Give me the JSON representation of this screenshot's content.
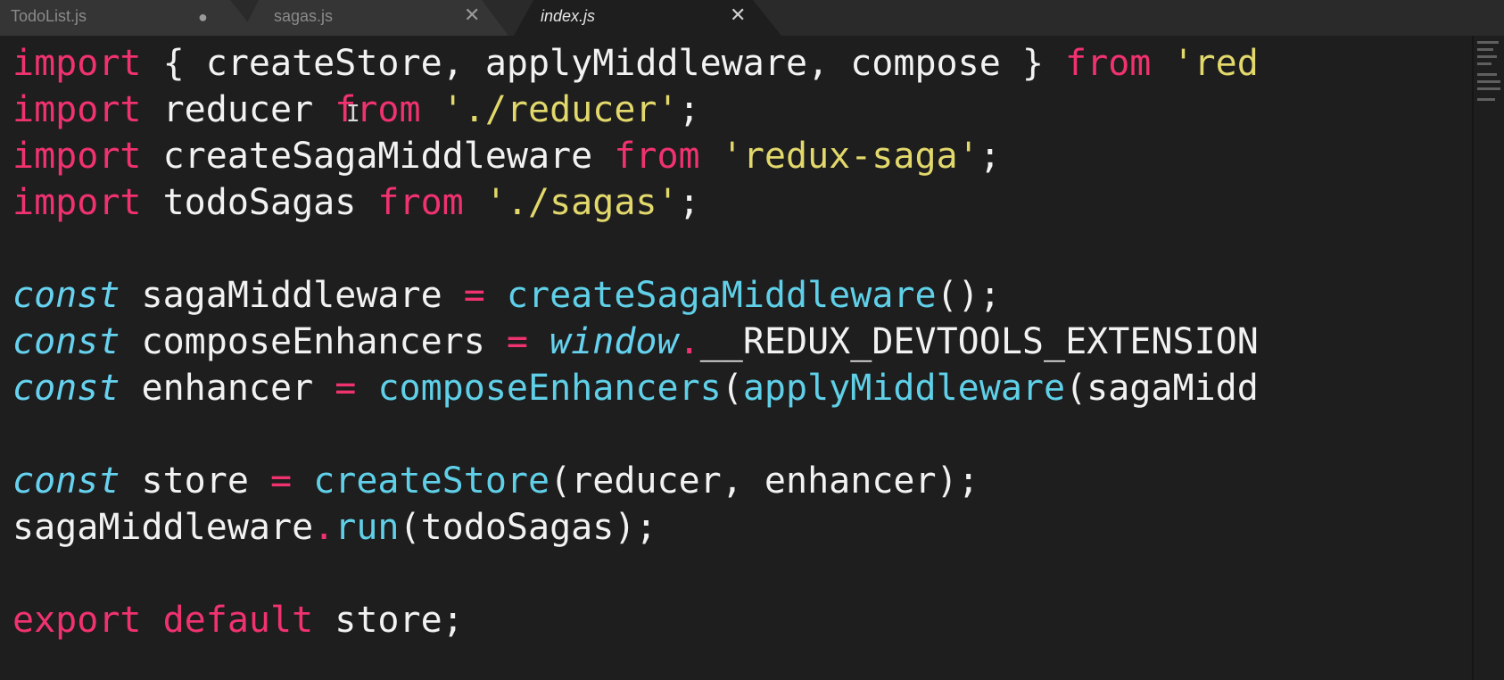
{
  "tabs": [
    {
      "label": "TodoList.js",
      "control": "●",
      "state": "modified"
    },
    {
      "label": "sagas.js",
      "control": "✕",
      "state": "saved"
    },
    {
      "label": "index.js",
      "control": "✕",
      "state": "active"
    }
  ],
  "code_lines": [
    [
      [
        "kw",
        "import"
      ],
      [
        "pl",
        " { createStore, applyMiddleware, compose } "
      ],
      [
        "kw",
        "from"
      ],
      [
        "pl",
        " "
      ],
      [
        "st",
        "'red"
      ]
    ],
    [
      [
        "kw",
        "import"
      ],
      [
        "pl",
        " reducer "
      ],
      [
        "kw",
        "from"
      ],
      [
        "pl",
        " "
      ],
      [
        "st",
        "'./reducer'"
      ],
      [
        "pl",
        ";"
      ]
    ],
    [
      [
        "kw",
        "import"
      ],
      [
        "pl",
        " createSagaMiddleware "
      ],
      [
        "kw",
        "from"
      ],
      [
        "pl",
        " "
      ],
      [
        "st",
        "'redux-saga'"
      ],
      [
        "pl",
        ";"
      ]
    ],
    [
      [
        "kw",
        "import"
      ],
      [
        "pl",
        " todoSagas "
      ],
      [
        "kw",
        "from"
      ],
      [
        "pl",
        " "
      ],
      [
        "st",
        "'./sagas'"
      ],
      [
        "pl",
        ";"
      ]
    ],
    [],
    [
      [
        "sc",
        "const"
      ],
      [
        "pl",
        " sagaMiddleware "
      ],
      [
        "op",
        "="
      ],
      [
        "pl",
        " "
      ],
      [
        "fn",
        "createSagaMiddleware"
      ],
      [
        "pl",
        "();"
      ]
    ],
    [
      [
        "sc",
        "const"
      ],
      [
        "pl",
        " composeEnhancers "
      ],
      [
        "op",
        "="
      ],
      [
        "pl",
        " "
      ],
      [
        "sc",
        "window"
      ],
      [
        "op",
        "."
      ],
      [
        "pl",
        "__REDUX_DEVTOOLS_EXTENSION"
      ]
    ],
    [
      [
        "sc",
        "const"
      ],
      [
        "pl",
        " enhancer "
      ],
      [
        "op",
        "="
      ],
      [
        "pl",
        " "
      ],
      [
        "fn",
        "composeEnhancers"
      ],
      [
        "pl",
        "("
      ],
      [
        "fn",
        "applyMiddleware"
      ],
      [
        "pl",
        "(sagaMidd"
      ]
    ],
    [],
    [
      [
        "sc",
        "const"
      ],
      [
        "pl",
        " store "
      ],
      [
        "op",
        "="
      ],
      [
        "pl",
        " "
      ],
      [
        "fn",
        "createStore"
      ],
      [
        "pl",
        "(reducer, enhancer);"
      ]
    ],
    [
      [
        "pl",
        "sagaMiddleware"
      ],
      [
        "op",
        "."
      ],
      [
        "fn",
        "run"
      ],
      [
        "pl",
        "(todoSagas);"
      ]
    ],
    [],
    [
      [
        "kw",
        "export"
      ],
      [
        "pl",
        " "
      ],
      [
        "kw",
        "default"
      ],
      [
        "pl",
        " store;"
      ]
    ]
  ],
  "colors": {
    "keyword": "#f0326f",
    "string": "#e2d86b",
    "storage": "#66d2ef",
    "function": "#5fd0e8",
    "plain": "#f2f2f2",
    "background": "#1e1e1e",
    "tabbar": "#2a2a2a"
  }
}
